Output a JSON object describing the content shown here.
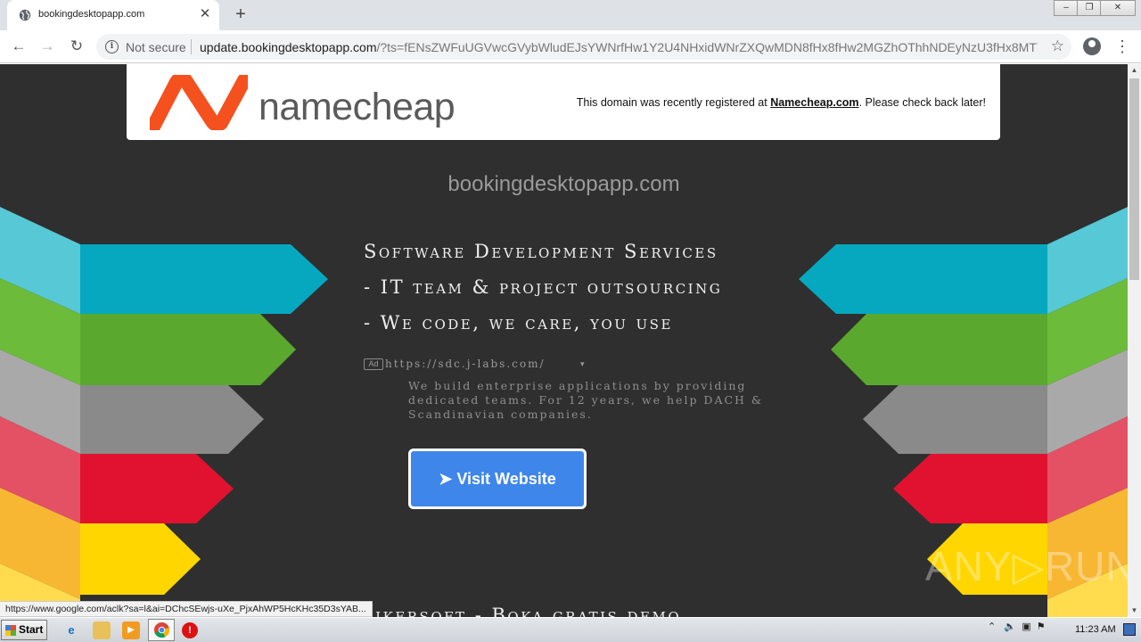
{
  "browser": {
    "tab_title": "bookingdesktopapp.com",
    "tab_close": "✕",
    "new_tab": "+",
    "security_label": "Not secure",
    "url_host": "update.bookingdesktopapp.com",
    "url_rest": "/?ts=fENsZWFuUGVwcGVybWludEJsYWNrfHw1Y2U4NHxidWNrZXQwMDN8fHx8fHw2MGZhOThhNDEyNzU3fHx8MTYy...",
    "status_url": "https://www.google.com/aclk?sa=l&ai=DChcSEwjs-uXe_PjxAhWP5HcKHc35D3sYAB..."
  },
  "banner": {
    "logo_text": "namecheap",
    "message_prefix": "This domain was recently registered at ",
    "message_link": "Namecheap.com",
    "message_suffix": ". Please check back later!"
  },
  "page": {
    "domain": "bookingdesktopapp.com",
    "headline_1": "Software Development Services",
    "headline_2": "- IT team & project outsourcing",
    "headline_3": "- We code, we care, you use",
    "ad_badge": "Ad",
    "ad_url": "https://sdc.j-labs.com/",
    "ad_caret": "▾",
    "ad_description": "We build enterprise applications by providing dedicated teams. For 12 years, we help DACH & Scandinavian companies.",
    "visit_button": "➤ Visit Website",
    "next_headline": "Strikersoft - Boka gratis demo",
    "watermark": "ANY▷RUN"
  },
  "taskbar": {
    "start_label": "Start",
    "clock": "11:23 AM"
  },
  "colors": {
    "page_bg": "#2f2f2f",
    "visit_button": "#3f86ea",
    "namecheap_orange": "#f4511e"
  }
}
